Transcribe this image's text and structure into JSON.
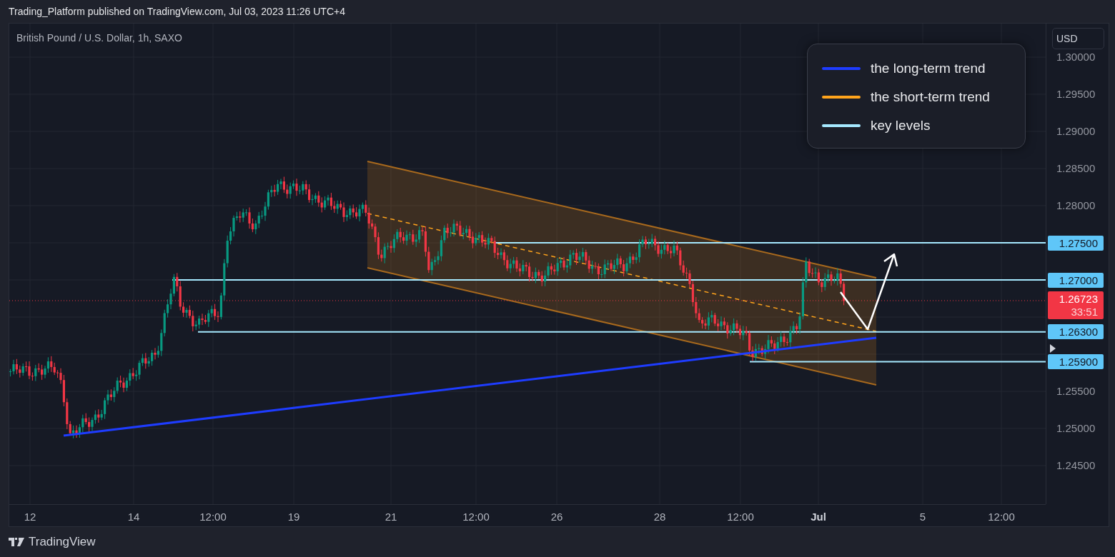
{
  "header": {
    "text": "Trading_Platform published on TradingView.com, Jul 03, 2023 11:26 UTC+4"
  },
  "chart": {
    "symbol_title": "British Pound / U.S. Dollar, 1h, SAXO",
    "currency_button": "USD",
    "legend": [
      {
        "label": "the long-term trend",
        "color": "#1e3cff"
      },
      {
        "label": "the short-term trend",
        "color": "#ffa41c"
      },
      {
        "label": "key levels",
        "color": "#a6e9ff"
      }
    ],
    "price_axis": {
      "ticks": [
        "1.30000",
        "1.29500",
        "1.29000",
        "1.28500",
        "1.28000",
        "1.25500",
        "1.25000",
        "1.24500"
      ]
    },
    "key_levels": [
      {
        "price": "1.27500"
      },
      {
        "price": "1.27000"
      },
      {
        "price": "1.26300"
      },
      {
        "price": "1.25900"
      }
    ],
    "last_price": {
      "price": "1.26723",
      "countdown": "33:51"
    },
    "time_axis": {
      "labels": [
        {
          "text": "12",
          "kind": "day"
        },
        {
          "text": "14",
          "kind": "day"
        },
        {
          "text": "12:00",
          "kind": "time"
        },
        {
          "text": "19",
          "kind": "day"
        },
        {
          "text": "21",
          "kind": "day"
        },
        {
          "text": "12:00",
          "kind": "time"
        },
        {
          "text": "26",
          "kind": "day"
        },
        {
          "text": "28",
          "kind": "day"
        },
        {
          "text": "12:00",
          "kind": "time"
        },
        {
          "text": "Jul",
          "kind": "month"
        },
        {
          "text": "5",
          "kind": "day"
        },
        {
          "text": "12:00",
          "kind": "time"
        }
      ]
    }
  },
  "footer": {
    "brand": "TradingView"
  }
}
